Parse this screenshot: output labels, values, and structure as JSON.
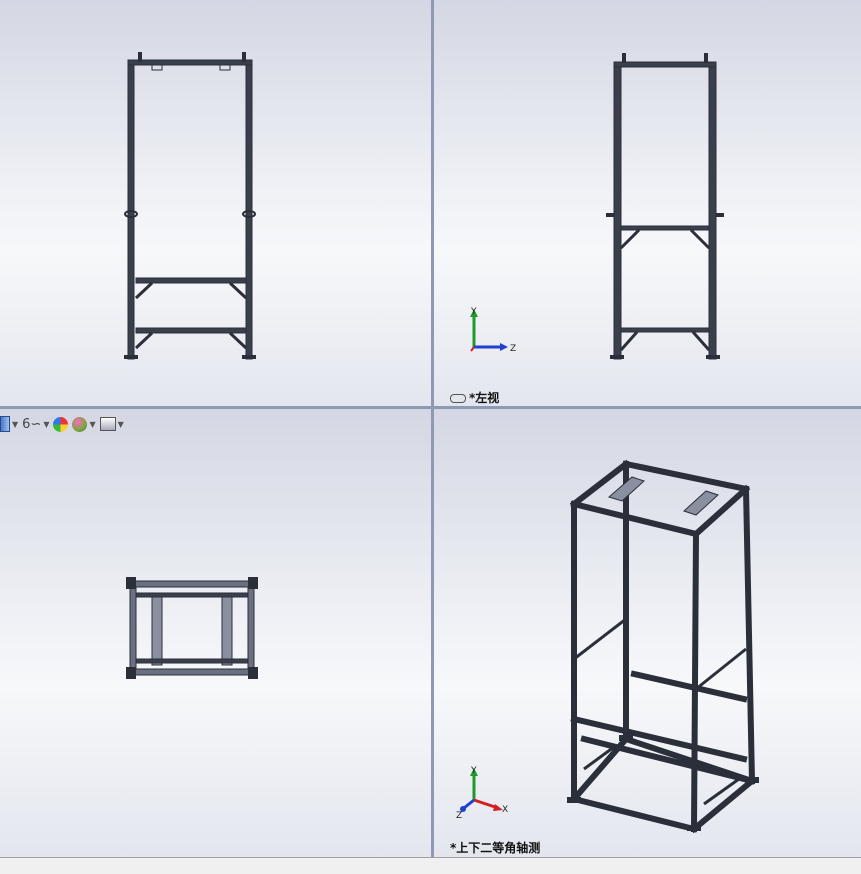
{
  "views": {
    "top_left": {
      "label": ""
    },
    "top_right": {
      "label": "*左视"
    },
    "bottom_left": {
      "label": ""
    },
    "bottom_right": {
      "label": "*上下二等角轴测"
    }
  },
  "triad": {
    "y": "Y",
    "z": "Z",
    "x": "X"
  },
  "heads_up_toolbar": {
    "items": [
      "view-orientation-icon",
      "hide-show-items-icon",
      "edit-appearance-icon",
      "apply-scene-icon",
      "view-settings-icon"
    ]
  },
  "colors": {
    "frame": "#2b2f3a",
    "frame_highlight": "#6a7080",
    "axis_x": "#d22020",
    "axis_y": "#1f9a2a",
    "axis_z": "#2040d0"
  }
}
